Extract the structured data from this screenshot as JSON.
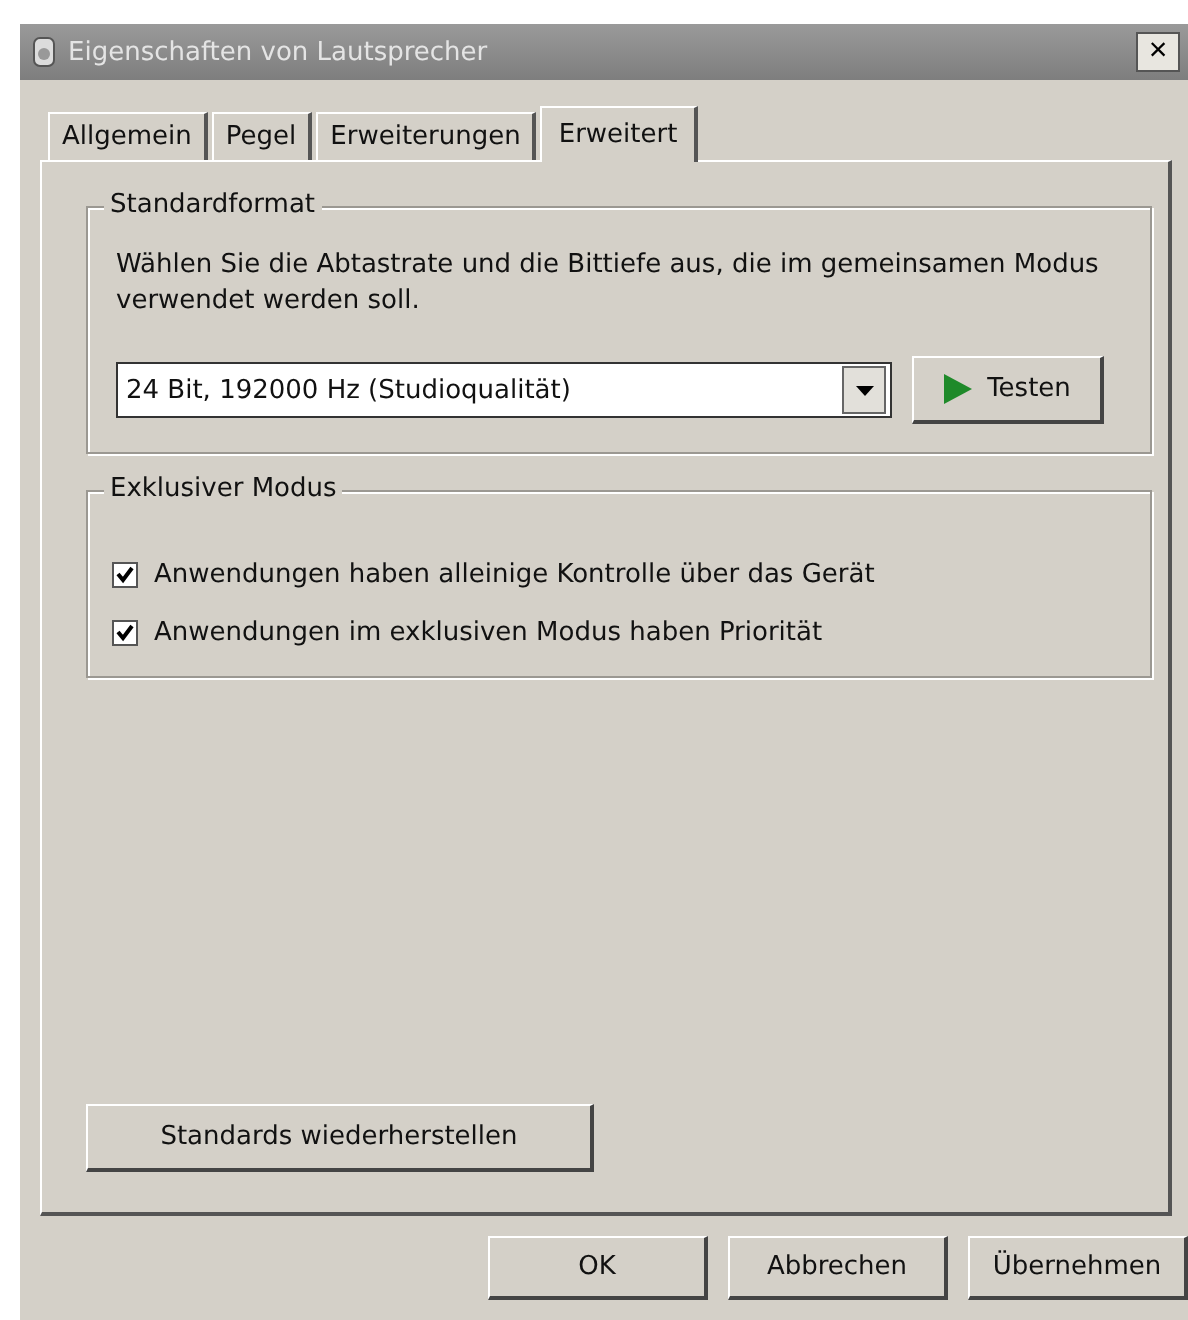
{
  "window": {
    "title": "Eigenschaften von Lautsprecher",
    "close": "×"
  },
  "tabs": [
    {
      "label": "Allgemein",
      "selected": false
    },
    {
      "label": "Pegel",
      "selected": false
    },
    {
      "label": "Erweiterungen",
      "selected": false
    },
    {
      "label": "Erweitert",
      "selected": true
    }
  ],
  "standard_format": {
    "title": "Standardformat",
    "description": "Wählen Sie die Abtastrate und die Bittiefe aus, die im gemeinsamen Modus verwendet werden soll.",
    "format": "24 Bit, 192000 Hz (Studioqualität)",
    "test_button": "Testen"
  },
  "exclusive_mode": {
    "title": "Exklusiver Modus",
    "options": [
      {
        "label": "Anwendungen haben alleinige Kontrolle über das Gerät",
        "checked": true
      },
      {
        "label": "Anwendungen im exklusiven Modus haben Priorität",
        "checked": true
      }
    ]
  },
  "restore_button": "Standards wiederherstellen",
  "buttons": [
    "OK",
    "Abbrechen",
    "Übernehmen"
  ]
}
